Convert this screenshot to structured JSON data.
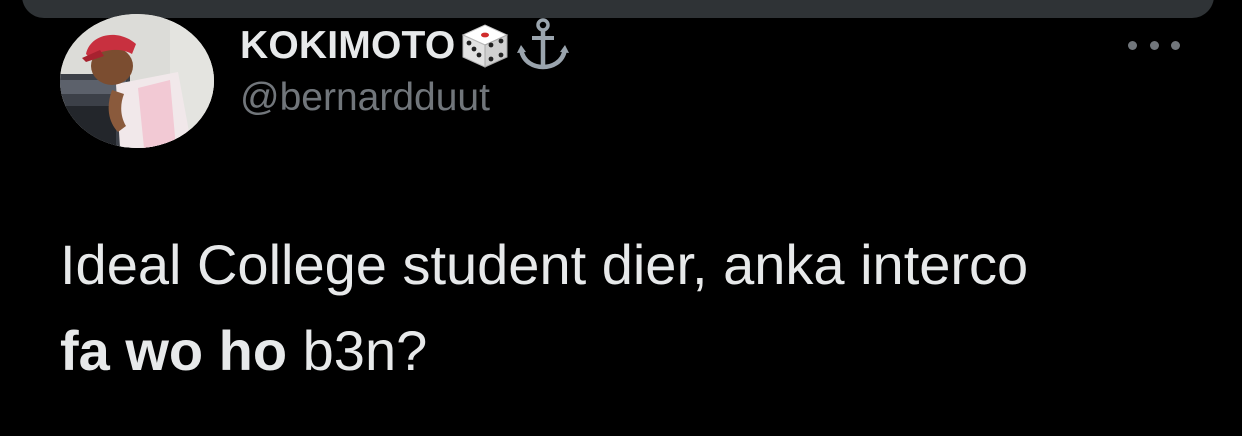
{
  "header": {
    "display_name": "KOKIMOTO",
    "emojis": [
      "game-die-emoji",
      "anchor-emoji"
    ],
    "handle": "@bernardduut"
  },
  "menu": {
    "icon": "more-horizontal-icon"
  },
  "tweet": {
    "line1": "Ideal College student dier, anka interco",
    "bold_text": "fa wo ho",
    "tail_text": " b3n?"
  },
  "colors": {
    "background": "#000000",
    "text": "#e7e9ea",
    "secondary": "#71767b",
    "top_bar": "#2f3336"
  }
}
